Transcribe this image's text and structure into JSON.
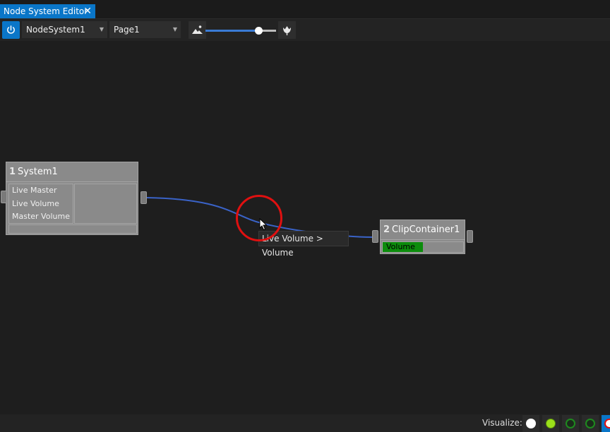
{
  "tab": {
    "title": "Node System Editor",
    "close_glyph": "✕"
  },
  "toolbar": {
    "power_icon": "power-icon",
    "system_select": "NodeSystem1",
    "page_select": "Page1",
    "zoom_out_icon": "landscape-icon",
    "zoom_in_icon": "flower-icon",
    "zoom_fraction": 0.75,
    "accent": "#0a76c8"
  },
  "nodes": [
    {
      "number": "1",
      "title": "System1",
      "inputs": [
        "Live Master",
        "Live Volume",
        "Master Volume"
      ]
    },
    {
      "number": "2",
      "title": "ClipContainer1",
      "parameters": [
        {
          "label": "Volume",
          "fraction": 0.5,
          "color": "#0c8c0c"
        }
      ]
    }
  ],
  "connection": {
    "from": "Live Volume",
    "to": "Volume",
    "color": "#3a63c8"
  },
  "tooltip": "Live Volume > Volume",
  "statusbar": {
    "visualize_label": "Visualize:",
    "options": [
      {
        "name": "white",
        "color": "#ffffff"
      },
      {
        "name": "lime",
        "color": "#9be01a"
      },
      {
        "name": "green-outline-1",
        "color": "#1e6e1e"
      },
      {
        "name": "green-outline-2",
        "color": "#1e6e1e"
      },
      {
        "name": "red-outline",
        "color": "#e01010"
      }
    ]
  }
}
